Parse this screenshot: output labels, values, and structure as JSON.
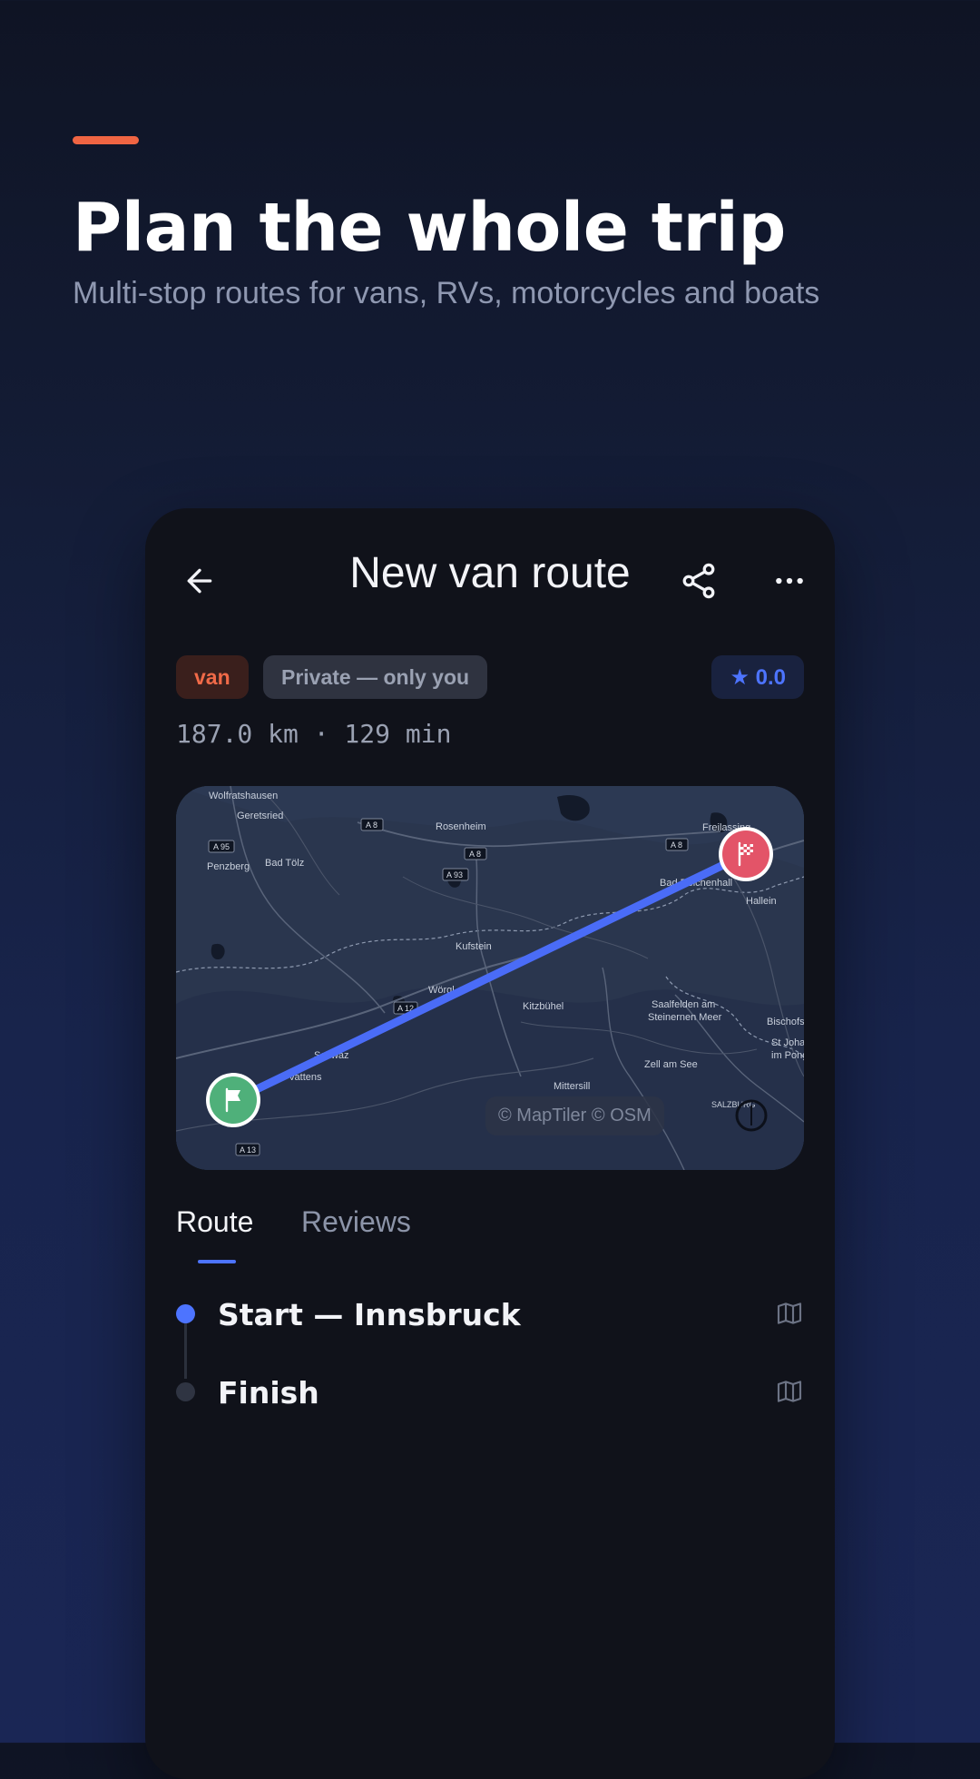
{
  "hero": {
    "title": "Plan the whole trip",
    "subtitle": "Multi-stop routes for vans, RVs, motorcycles and boats",
    "accent_color": "#f06543"
  },
  "app": {
    "header": {
      "title": "New van route",
      "back_icon": "arrow-left-icon",
      "share_icon": "share-icon",
      "more_icon": "more-horizontal-icon"
    },
    "chips": {
      "vehicle": "van",
      "visibility": "Private — only you",
      "rating": "★ 0.0"
    },
    "stats": "187.0 km · 129 min",
    "map": {
      "credit": "© MapTiler © OSM",
      "start_marker_icon": "flag-icon",
      "finish_marker_icon": "checkered-flag-icon",
      "route_color": "#4a6cf7",
      "start_color": "#4fb07a",
      "finish_color": "#e35468",
      "places": {
        "wolfratshausen": "Wolfratshausen",
        "geretsried": "Geretsried",
        "penzberg": "Penzberg",
        "bad_tolz": "Bad Tölz",
        "rosenheim": "Rosenheim",
        "freilassing": "Freilassing",
        "bad_reichenhall": "Bad Reichenhall",
        "hallein": "Hallein",
        "kufstein": "Kufstein",
        "worgl": "Wörgl",
        "kitzbuhel": "Kitzbühel",
        "saalfelden": "Saalfelden am",
        "saalfelden_2": "Steinernen Meer",
        "bischofs": "Bischofs",
        "st_johann": "St Joha",
        "st_johann_2": "im Pong",
        "zell": "Zell am See",
        "mittersill": "Mittersill",
        "schwaz": "Schwaz",
        "vattens": "Vattens",
        "salzburg": "SALZBURG"
      },
      "roads": {
        "a95": "A 95",
        "a8_1": "A 8",
        "a8_2": "A 8",
        "a8_3": "A 8",
        "a93": "A 93",
        "a12": "A 12",
        "a13": "A 13"
      }
    },
    "tabs": {
      "route": "Route",
      "reviews": "Reviews",
      "active": "Route"
    },
    "stops": [
      {
        "label": "Start — Innsbruck",
        "icon": "map-icon",
        "active": true
      },
      {
        "label": "Finish",
        "icon": "map-icon",
        "active": false
      }
    ]
  }
}
